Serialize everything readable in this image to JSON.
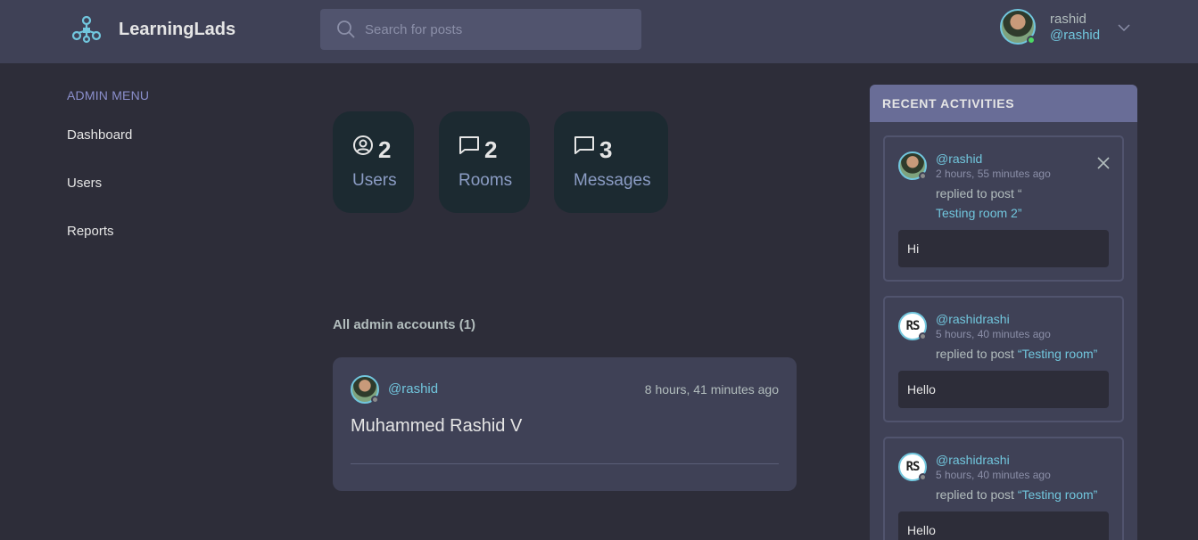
{
  "brand": {
    "name": "LearningLads"
  },
  "search": {
    "placeholder": "Search for posts"
  },
  "user": {
    "name": "rashid",
    "handle": "@rashid"
  },
  "sidebar": {
    "title": "ADMIN MENU",
    "items": [
      {
        "label": "Dashboard"
      },
      {
        "label": "Users"
      },
      {
        "label": "Reports"
      }
    ]
  },
  "stats": [
    {
      "icon": "user-circle-icon",
      "count": "2",
      "label": "Users"
    },
    {
      "icon": "chat-bubble-icon",
      "count": "2",
      "label": "Rooms"
    },
    {
      "icon": "chat-bubble-icon",
      "count": "3",
      "label": "Messages"
    }
  ],
  "accounts": {
    "title": "All admin accounts (1)",
    "items": [
      {
        "handle": "@rashid",
        "time": "8 hours, 41 minutes ago",
        "name": "Muhammed Rashid V"
      }
    ]
  },
  "activities": {
    "title": "RECENT ACTIVITIES",
    "items": [
      {
        "handle": "@rashid",
        "time": "2 hours, 55 minutes ago",
        "action": "replied to post “",
        "post": "Testing room 2",
        "post_close": "”",
        "message": "Hi"
      },
      {
        "handle": "@rashidrashi",
        "time": "5 hours, 40 minutes ago",
        "action": "replied to post ",
        "post": "“Testing room”",
        "post_close": "",
        "message": "Hello"
      },
      {
        "handle": "@rashidrashi",
        "time": "5 hours, 40 minutes ago",
        "action": "replied to post ",
        "post": "“Testing room”",
        "post_close": "",
        "message": "Hello"
      }
    ]
  },
  "colors": {
    "background": "#2d2d39",
    "header": "#3f4156",
    "accent": "#71c6dd",
    "stat_card": "#1c2a31",
    "activities_header": "#696d97"
  }
}
